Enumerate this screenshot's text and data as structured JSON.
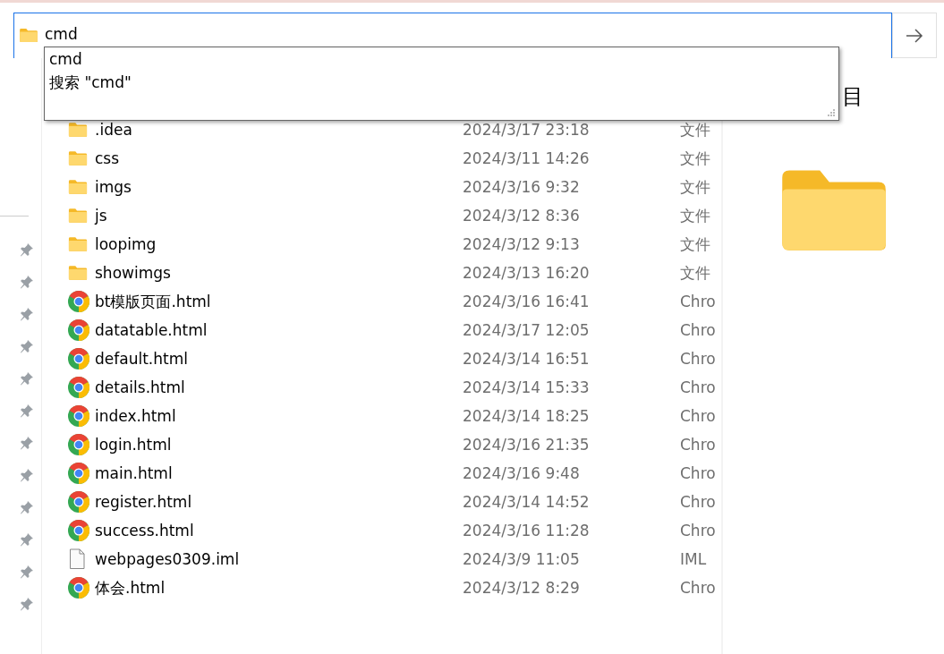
{
  "address_bar": {
    "value": "cmd"
  },
  "suggestions": [
    {
      "text": "cmd"
    },
    {
      "text": "搜索 \"cmd\""
    }
  ],
  "preview": {
    "title": "目"
  },
  "files": [
    {
      "kind": "folder",
      "name": ".idea",
      "date": "2024/3/17 23:18",
      "type": "文件"
    },
    {
      "kind": "folder",
      "name": "css",
      "date": "2024/3/11 14:26",
      "type": "文件"
    },
    {
      "kind": "folder",
      "name": "imgs",
      "date": "2024/3/16 9:32",
      "type": "文件"
    },
    {
      "kind": "folder",
      "name": "js",
      "date": "2024/3/12 8:36",
      "type": "文件"
    },
    {
      "kind": "folder",
      "name": "loopimg",
      "date": "2024/3/12 9:13",
      "type": "文件"
    },
    {
      "kind": "folder",
      "name": "showimgs",
      "date": "2024/3/13 16:20",
      "type": "文件"
    },
    {
      "kind": "chrome",
      "name": "bt模版页面.html",
      "date": "2024/3/16 16:41",
      "type": "Chro"
    },
    {
      "kind": "chrome",
      "name": "datatable.html",
      "date": "2024/3/17 12:05",
      "type": "Chro"
    },
    {
      "kind": "chrome",
      "name": "default.html",
      "date": "2024/3/14 16:51",
      "type": "Chro"
    },
    {
      "kind": "chrome",
      "name": "details.html",
      "date": "2024/3/14 15:33",
      "type": "Chro"
    },
    {
      "kind": "chrome",
      "name": "index.html",
      "date": "2024/3/14 18:25",
      "type": "Chro"
    },
    {
      "kind": "chrome",
      "name": "login.html",
      "date": "2024/3/16 21:35",
      "type": "Chro"
    },
    {
      "kind": "chrome",
      "name": "main.html",
      "date": "2024/3/16 9:48",
      "type": "Chro"
    },
    {
      "kind": "chrome",
      "name": "register.html",
      "date": "2024/3/14 14:52",
      "type": "Chro"
    },
    {
      "kind": "chrome",
      "name": "success.html",
      "date": "2024/3/16 11:28",
      "type": "Chro"
    },
    {
      "kind": "file",
      "name": "webpages0309.iml",
      "date": "2024/3/9 11:05",
      "type": "IML"
    },
    {
      "kind": "chrome",
      "name": "体会.html",
      "date": "2024/3/12 8:29",
      "type": "Chro"
    }
  ]
}
